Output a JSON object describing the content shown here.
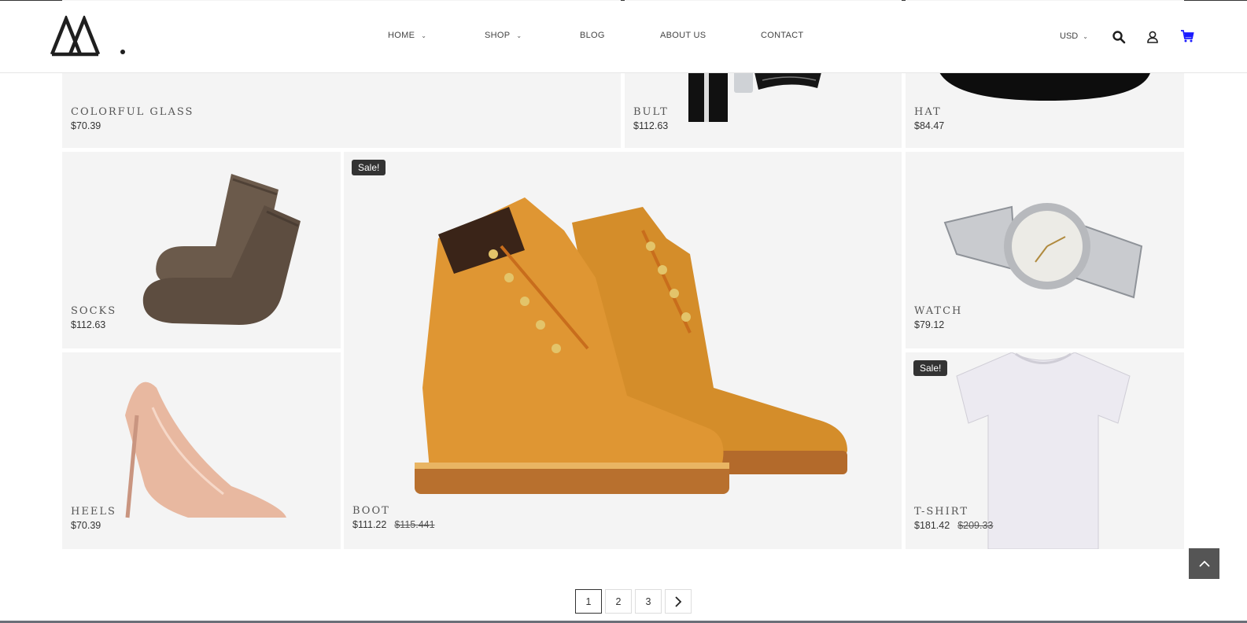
{
  "nav": {
    "items": [
      {
        "label": "HOME",
        "dropdown": true
      },
      {
        "label": "SHOP",
        "dropdown": true
      },
      {
        "label": "BLOG",
        "dropdown": false
      },
      {
        "label": "ABOUT US",
        "dropdown": false
      },
      {
        "label": "CONTACT",
        "dropdown": false
      }
    ],
    "currency": "USD",
    "icons": [
      "logo-mountains-icon",
      "search-icon",
      "user-icon",
      "cart-icon"
    ],
    "cart_color": "#1a1aff"
  },
  "products": [
    {
      "name": "COLORFUL GLASS",
      "price": "$70.39"
    },
    {
      "name": "BULT",
      "price": "$112.63"
    },
    {
      "name": "HAT",
      "price": "$84.47"
    },
    {
      "name": "SOCKS",
      "price": "$112.63"
    },
    {
      "name": "BOOT",
      "price": "$111.22",
      "old_price": "$115.441",
      "badge": "Sale!"
    },
    {
      "name": "WATCH",
      "price": "$79.12"
    },
    {
      "name": "HEELS",
      "price": "$70.39"
    },
    {
      "name": "T-SHIRT",
      "price": "$181.42",
      "old_price": "$209.33",
      "badge": "Sale!"
    }
  ],
  "pagination": {
    "pages": [
      "1",
      "2",
      "3"
    ],
    "active": "1",
    "next_icon": "chevron-right-icon"
  },
  "back_to_top_icon": "chevron-up-icon"
}
